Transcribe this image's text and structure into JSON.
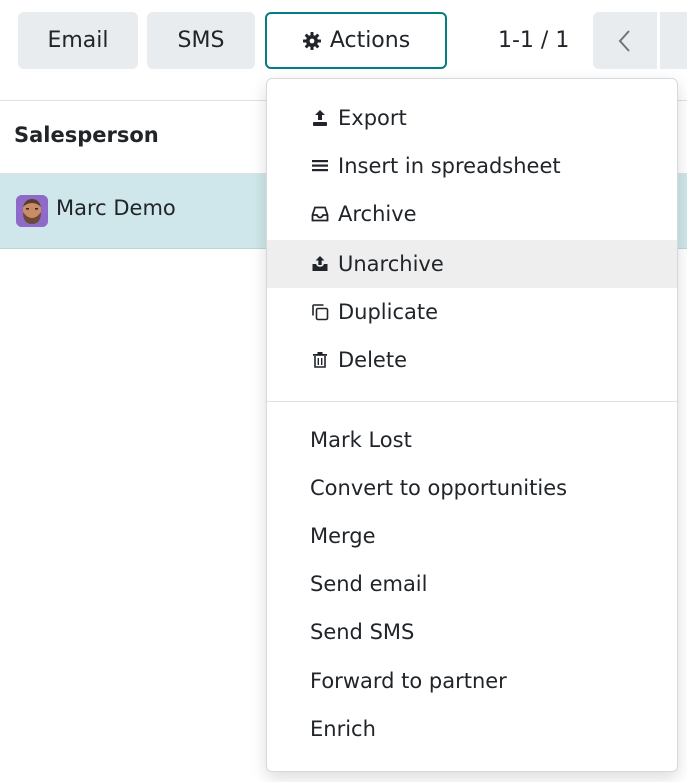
{
  "toolbar": {
    "email_label": "Email",
    "sms_label": "SMS",
    "actions_label": "Actions",
    "pager_value": "1-1 / 1"
  },
  "list": {
    "column_salesperson": "Salesperson",
    "rows": [
      {
        "salesperson": "Marc Demo"
      }
    ]
  },
  "actions_menu": {
    "group1": [
      {
        "label": "Export",
        "icon": "export-icon"
      },
      {
        "label": "Insert in spreadsheet",
        "icon": "list-icon"
      },
      {
        "label": "Archive",
        "icon": "archive-icon"
      },
      {
        "label": "Unarchive",
        "icon": "unarchive-icon",
        "highlighted": true
      },
      {
        "label": "Duplicate",
        "icon": "duplicate-icon"
      },
      {
        "label": "Delete",
        "icon": "trash-icon"
      }
    ],
    "group2": [
      {
        "label": "Mark Lost"
      },
      {
        "label": "Convert to opportunities"
      },
      {
        "label": "Merge"
      },
      {
        "label": "Send email"
      },
      {
        "label": "Send SMS"
      },
      {
        "label": "Forward to partner"
      },
      {
        "label": "Enrich"
      }
    ]
  },
  "colors": {
    "accent": "#017e84",
    "selected_row": "#cfe7ea",
    "button_bg": "#e9ecef"
  }
}
